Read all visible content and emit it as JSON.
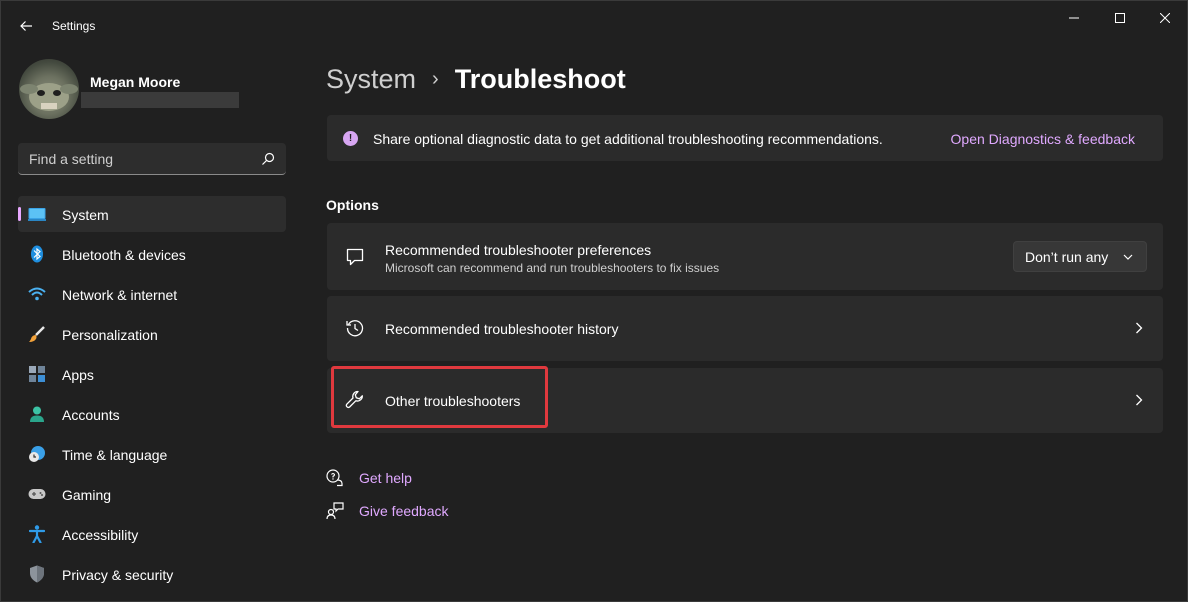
{
  "window": {
    "app_title": "Settings"
  },
  "profile": {
    "name": "Megan Moore"
  },
  "search": {
    "placeholder": "Find a setting"
  },
  "sidebar": {
    "items": [
      {
        "label": "System",
        "icon": "monitor-icon",
        "active": true
      },
      {
        "label": "Bluetooth & devices",
        "icon": "bluetooth-icon"
      },
      {
        "label": "Network & internet",
        "icon": "wifi-icon"
      },
      {
        "label": "Personalization",
        "icon": "brush-icon"
      },
      {
        "label": "Apps",
        "icon": "apps-icon"
      },
      {
        "label": "Accounts",
        "icon": "person-icon"
      },
      {
        "label": "Time & language",
        "icon": "clock-globe-icon"
      },
      {
        "label": "Gaming",
        "icon": "gamepad-icon"
      },
      {
        "label": "Accessibility",
        "icon": "accessibility-icon"
      },
      {
        "label": "Privacy & security",
        "icon": "shield-icon"
      }
    ]
  },
  "breadcrumb": {
    "parent": "System",
    "separator": "›",
    "current": "Troubleshoot"
  },
  "info_bar": {
    "text": "Share optional diagnostic data to get additional troubleshooting recommendations.",
    "link": "Open Diagnostics & feedback"
  },
  "options": {
    "section_title": "Options",
    "preferences": {
      "title": "Recommended troubleshooter preferences",
      "description": "Microsoft can recommend and run troubleshooters to fix issues",
      "selected": "Don’t run any"
    },
    "history": {
      "title": "Recommended troubleshooter history"
    },
    "other": {
      "title": "Other troubleshooters"
    }
  },
  "help": {
    "get_help": "Get help",
    "give_feedback": "Give feedback"
  },
  "colors": {
    "accent": "#e0a9ff",
    "highlight": "#e0393e",
    "background": "#202020",
    "card": "#2b2b2b"
  }
}
